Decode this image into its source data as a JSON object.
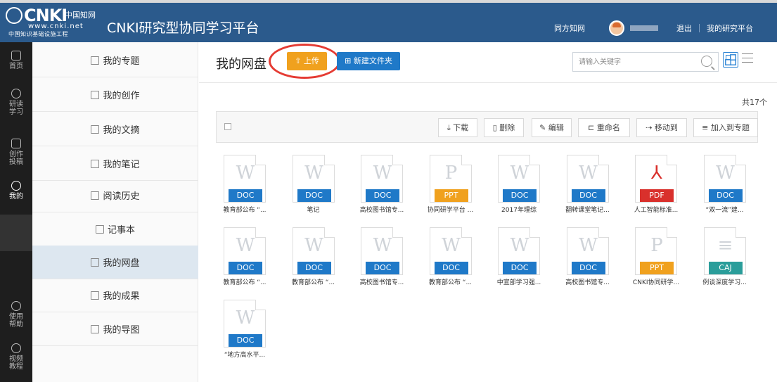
{
  "header": {
    "logo_cnki": "CNKI",
    "logo_cn": "中国知网",
    "logo_url": "www.cnki.net",
    "logo_sub": "中国知识基础设施工程",
    "app_title": "CNKI研究型协同学习平台",
    "links": [
      "同方知网",
      "退出",
      "我的研究平台"
    ]
  },
  "rail": [
    {
      "label": "首页",
      "icon": "home-icon"
    },
    {
      "label": "研读\n学习",
      "icon": "study-icon"
    },
    {
      "label": "创作\n投稿",
      "icon": "edit-icon"
    },
    {
      "label": "我的",
      "icon": "my-icon",
      "active": true
    },
    {
      "label": "使用\n帮助",
      "icon": "help-icon"
    },
    {
      "label": "视频\n教程",
      "icon": "video-icon"
    }
  ],
  "nav": [
    {
      "label": "我的专题",
      "icon": "folder-icon"
    },
    {
      "label": "我的创作",
      "icon": "write-icon"
    },
    {
      "label": "我的文摘",
      "icon": "excerpt-icon"
    },
    {
      "label": "我的笔记",
      "icon": "note-icon"
    },
    {
      "label": "阅读历史",
      "icon": "history-icon"
    },
    {
      "label": "记事本",
      "icon": "notebook-icon"
    },
    {
      "label": "我的网盘",
      "icon": "disk-icon",
      "active": true
    },
    {
      "label": "我的成果",
      "icon": "result-icon"
    },
    {
      "label": "我的导图",
      "icon": "mindmap-icon"
    }
  ],
  "main": {
    "title": "我的网盘",
    "upload_label": "上传",
    "new_folder_label": "新建文件夹",
    "search_placeholder": "请输入关键字",
    "total": "共17个"
  },
  "toolbar": [
    "下载",
    "删除",
    "编辑",
    "重命名",
    "移动到",
    "加入到专题"
  ],
  "colors": {
    "header": "#2b5a8c",
    "doc": "#1f79c8",
    "ppt": "#f0a11e",
    "pdf": "#d9302c",
    "caj": "#2a9d9a",
    "upload": "#f0a11e"
  },
  "files": [
    {
      "type": "DOC",
      "name": "教育部公布 “..."
    },
    {
      "type": "DOC",
      "name": "笔记"
    },
    {
      "type": "DOC",
      "name": "高校图书馆专..."
    },
    {
      "type": "PPT",
      "name": "协同研学平台 ..."
    },
    {
      "type": "DOC",
      "name": "2017年理综"
    },
    {
      "type": "DOC",
      "name": "翻转课堂笔记..."
    },
    {
      "type": "PDF",
      "name": "人工智能标准..."
    },
    {
      "type": "DOC",
      "name": "“双一流”建..."
    },
    {
      "type": "DOC",
      "name": "教育部公布 “..."
    },
    {
      "type": "DOC",
      "name": "教育部公布 “..."
    },
    {
      "type": "DOC",
      "name": "高校图书馆专..."
    },
    {
      "type": "DOC",
      "name": "教育部公布 “..."
    },
    {
      "type": "DOC",
      "name": "中宣部学习强..."
    },
    {
      "type": "DOC",
      "name": "高校图书馆专..."
    },
    {
      "type": "PPT",
      "name": "CNKI协同研学..."
    },
    {
      "type": "CAJ",
      "name": "例谈深度学习..."
    },
    {
      "type": "DOC",
      "name": "“地方高水平..."
    }
  ]
}
